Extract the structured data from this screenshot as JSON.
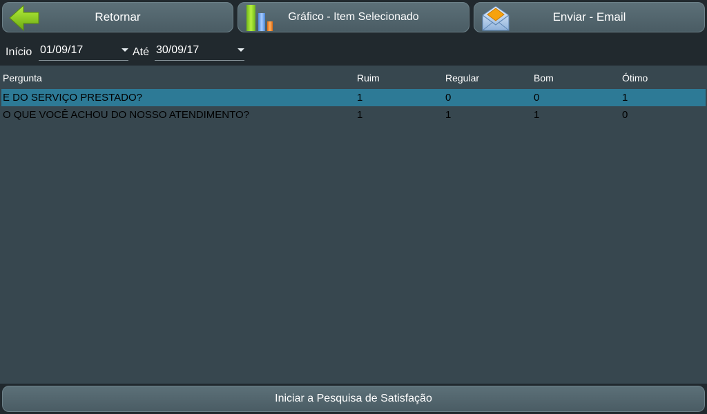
{
  "toolbar": {
    "back_label": "Retornar",
    "chart_label": "Gráfico - Item Selecionado",
    "email_label": "Enviar - Email",
    "back_icon": "arrow-left-icon",
    "chart_icon": "bar-chart-icon",
    "email_icon": "envelope-icon"
  },
  "filters": {
    "start_label": "Início",
    "start_value": "01/09/17",
    "end_label": "Até",
    "end_value": "30/09/17"
  },
  "table": {
    "columns": [
      "Pergunta",
      "Ruim",
      "Regular",
      "Bom",
      "Ótimo"
    ],
    "rows": [
      {
        "pergunta": "E DO SERVIÇO PRESTADO?",
        "ruim": "1",
        "regular": "0",
        "bom": "0",
        "otimo": "1",
        "selected": true
      },
      {
        "pergunta": "O QUE VOCÊ ACHOU DO NOSSO ATENDIMENTO?",
        "ruim": "1",
        "regular": "1",
        "bom": "1",
        "otimo": "0",
        "selected": false
      }
    ]
  },
  "footer": {
    "start_survey_label": "Iniciar a Pesquisa de Satisfação"
  },
  "colors": {
    "background": "#21292e",
    "panel": "#37474f",
    "button": "#52666e",
    "selected_row": "#2d7a96",
    "arrow_green": "#8ccc1e"
  }
}
